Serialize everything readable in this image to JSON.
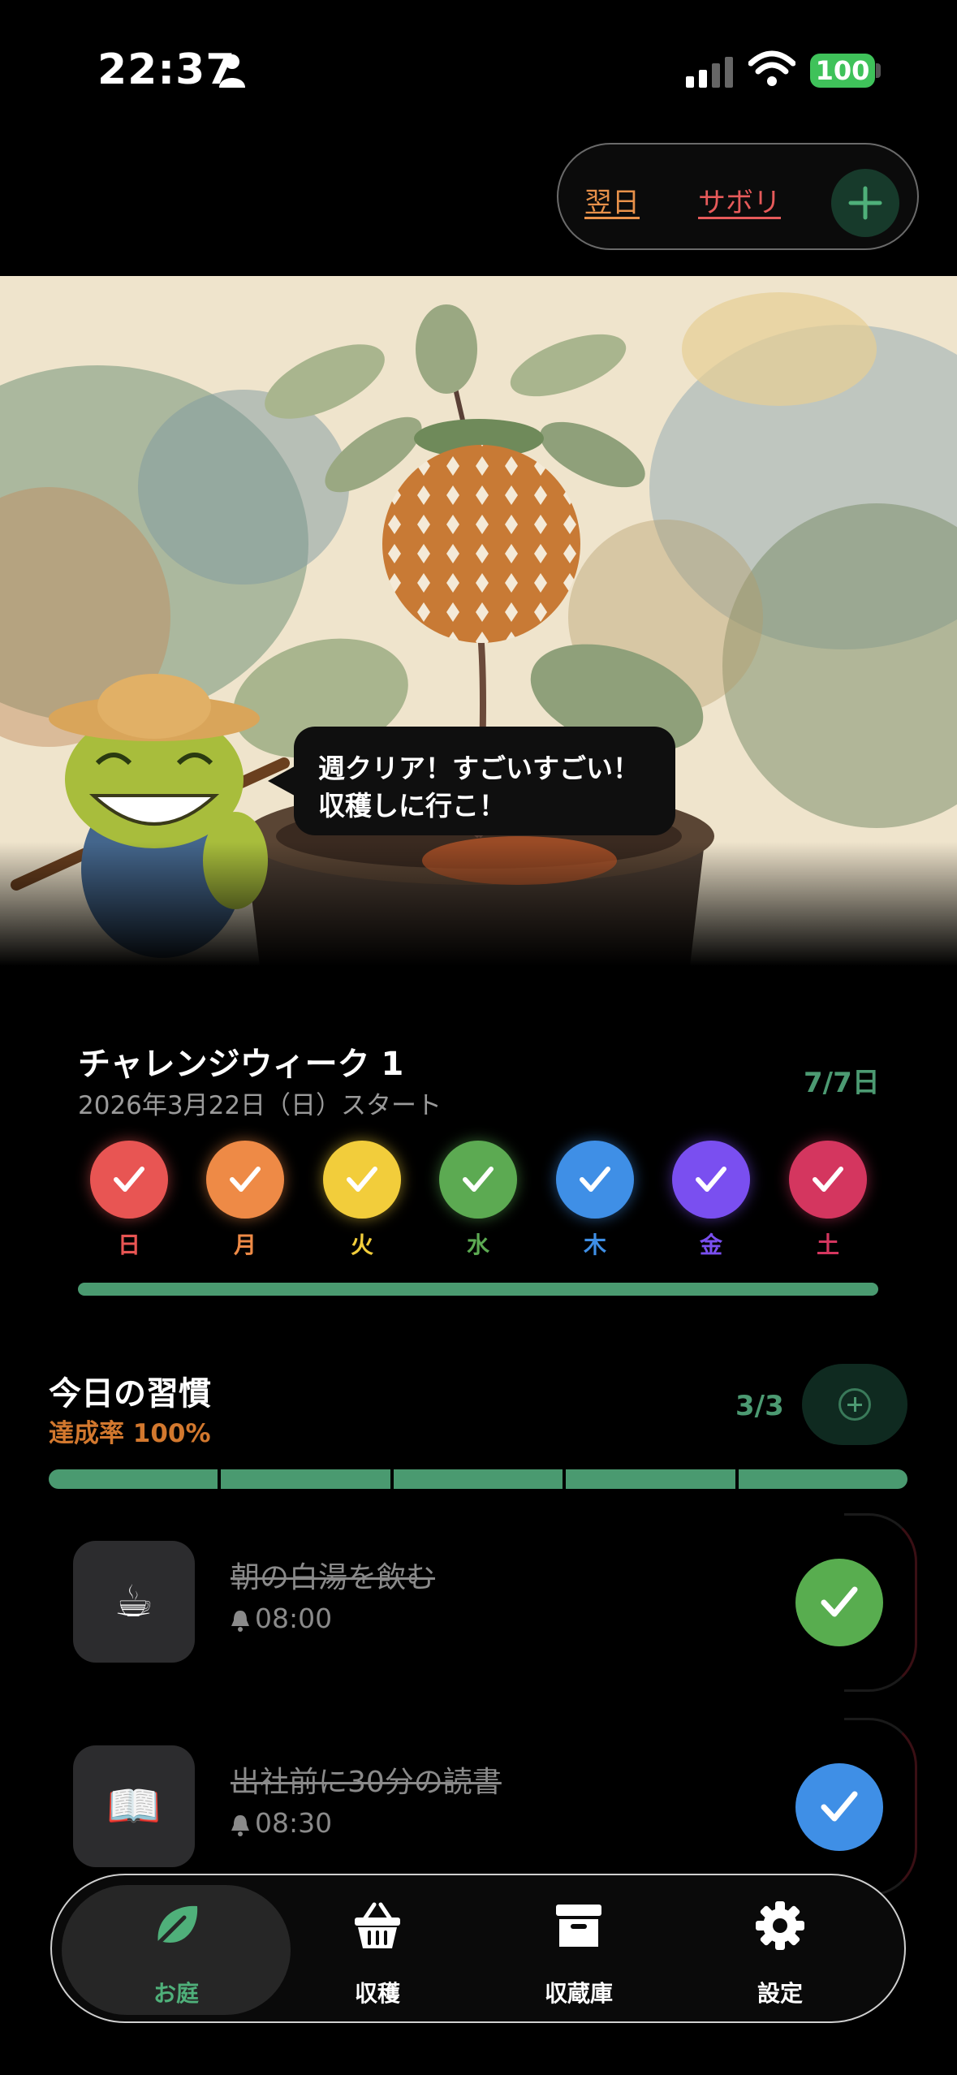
{
  "status_bar": {
    "time": "22:37",
    "battery": "100"
  },
  "top_actions": {
    "next_day": "翌日",
    "skip": "サボリ"
  },
  "speech": {
    "line1": "週クリア！すごいすごい！",
    "line2": "収穫しに行こ！"
  },
  "challenge": {
    "title": "チャレンジウィーク 1",
    "start": "2026年3月22日（日）スタート",
    "count": "7/7日",
    "progress": 1.0,
    "days": [
      {
        "label": "日",
        "color": "#e85553",
        "done": true
      },
      {
        "label": "月",
        "color": "#ee8a46",
        "done": true
      },
      {
        "label": "火",
        "color": "#f2cd3b",
        "done": true
      },
      {
        "label": "水",
        "color": "#5caa52",
        "done": true
      },
      {
        "label": "木",
        "color": "#3f8fe6",
        "done": true
      },
      {
        "label": "金",
        "color": "#7a4ff0",
        "done": true
      },
      {
        "label": "土",
        "color": "#d4365f",
        "done": true
      }
    ]
  },
  "habits": {
    "title": "今日の習慣",
    "rate": "達成率 100%",
    "count": "3/3",
    "items": [
      {
        "icon": "☕",
        "name": "朝の白湯を飲む",
        "time": "08:00",
        "check_color": "#58ad4f"
      },
      {
        "icon": "📖",
        "name": "出社前に30分の読書",
        "time": "08:30",
        "check_color": "#3f8fe6"
      }
    ]
  },
  "tabs": [
    {
      "label": "お庭",
      "icon": "leaf-icon",
      "active": true
    },
    {
      "label": "収穫",
      "icon": "basket-icon",
      "active": false
    },
    {
      "label": "収蔵庫",
      "icon": "archive-box-icon",
      "active": false
    },
    {
      "label": "設定",
      "icon": "gear-icon",
      "active": false
    }
  ],
  "colors": {
    "accent_green": "#4a9a70",
    "rate_orange": "#d2782e"
  }
}
